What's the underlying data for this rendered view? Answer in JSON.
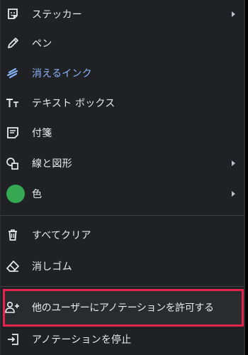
{
  "menu": {
    "items": [
      {
        "label": "ステッカー",
        "icon": "sticker-icon",
        "submenu": true
      },
      {
        "label": "ペン",
        "icon": "pen-icon",
        "submenu": false
      },
      {
        "label": "消えるインク",
        "icon": "laser-ink-icon",
        "submenu": false
      },
      {
        "label": "テキスト ボックス",
        "icon": "text-box-icon",
        "submenu": false
      },
      {
        "label": "付箋",
        "icon": "sticky-note-icon",
        "submenu": false
      },
      {
        "label": "線と図形",
        "icon": "shapes-icon",
        "submenu": true
      },
      {
        "label": "色",
        "icon": "color-circle-icon",
        "submenu": true
      },
      {
        "label": "すべてクリア",
        "icon": "trash-icon",
        "submenu": false
      },
      {
        "label": "消しゴム",
        "icon": "eraser-icon",
        "submenu": false
      },
      {
        "label": "他のユーザーにアノテーションを許可する",
        "icon": "person-add-icon",
        "submenu": false
      },
      {
        "label": "アノテーションを停止",
        "icon": "exit-icon",
        "submenu": false
      }
    ],
    "selected_color": "#34a853",
    "accent_color": "#8ab4f8",
    "highlight_border_color": "#e4244a"
  }
}
